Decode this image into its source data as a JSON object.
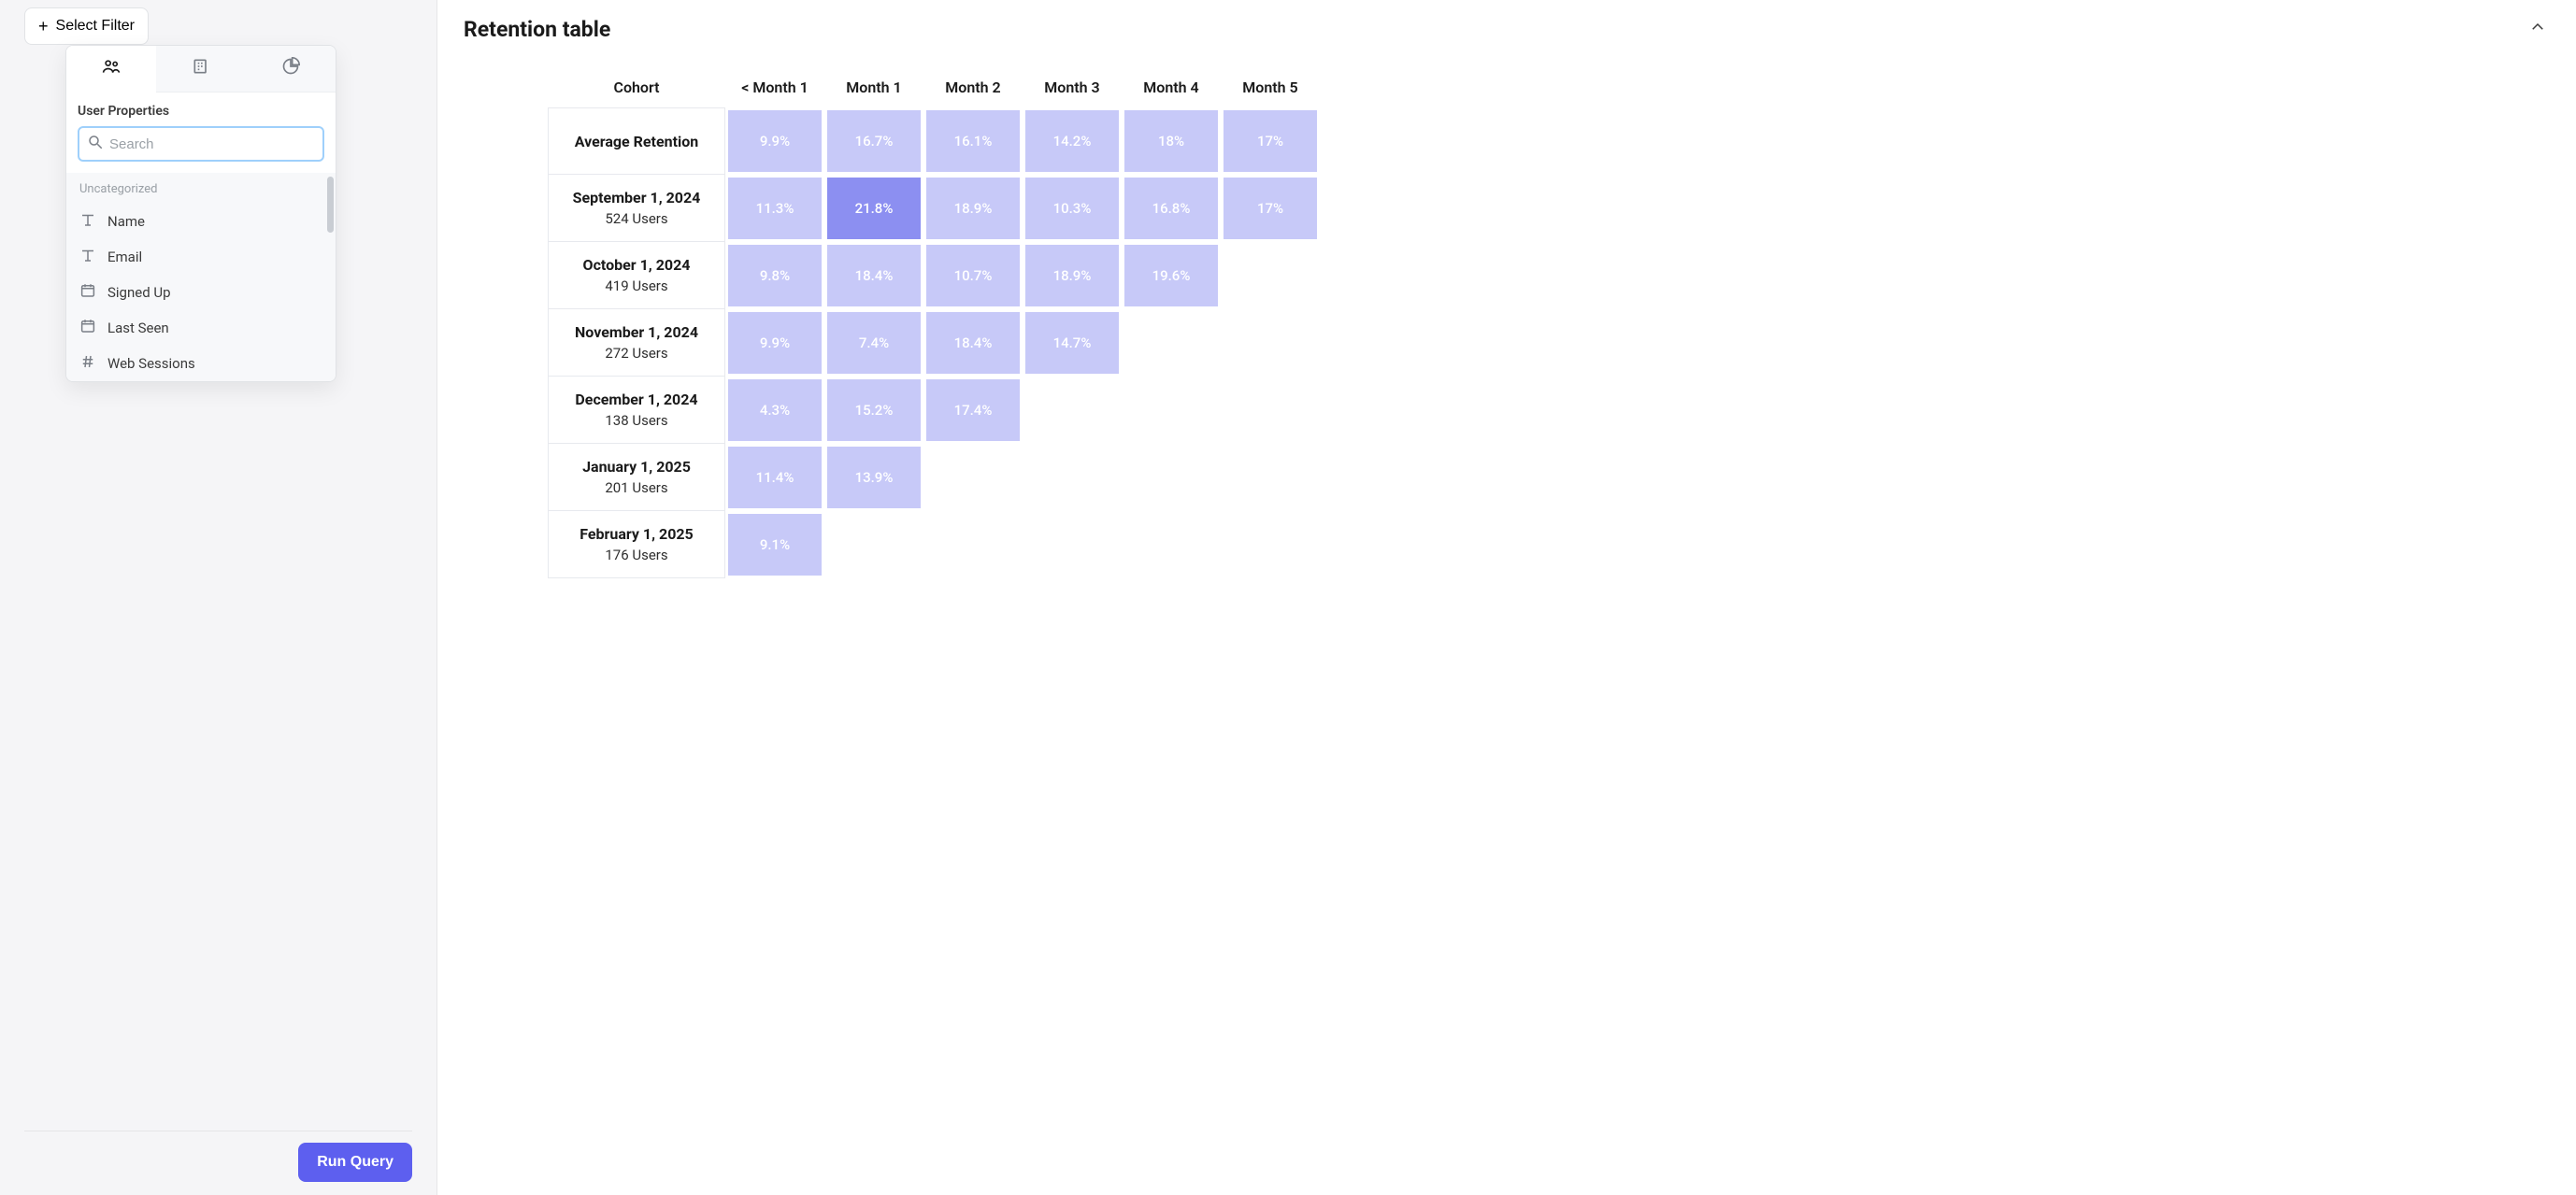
{
  "sidebar": {
    "select_filter_label": "Select Filter",
    "popover": {
      "section_title": "User Properties",
      "search_placeholder": "Search",
      "group_label": "Uncategorized",
      "items": [
        {
          "label": "Name",
          "icon": "text"
        },
        {
          "label": "Email",
          "icon": "text"
        },
        {
          "label": "Signed Up",
          "icon": "date"
        },
        {
          "label": "Last Seen",
          "icon": "date"
        },
        {
          "label": "Web Sessions",
          "icon": "number"
        }
      ]
    }
  },
  "footer": {
    "run_query_label": "Run Query"
  },
  "main": {
    "title": "Retention table"
  },
  "chart_data": {
    "type": "heatmap",
    "title": "Retention table",
    "column_header": "Cohort",
    "columns": [
      "< Month 1",
      "Month 1",
      "Month 2",
      "Month 3",
      "Month 4",
      "Month 5"
    ],
    "rows": [
      {
        "name": "Average Retention",
        "subtitle": null,
        "values": [
          "9.9%",
          "16.7%",
          "16.1%",
          "14.2%",
          "18%",
          "17%"
        ]
      },
      {
        "name": "September 1, 2024",
        "subtitle": "524 Users",
        "values": [
          "11.3%",
          "21.8%",
          "18.9%",
          "10.3%",
          "16.8%",
          "17%"
        ]
      },
      {
        "name": "October 1, 2024",
        "subtitle": "419 Users",
        "values": [
          "9.8%",
          "18.4%",
          "10.7%",
          "18.9%",
          "19.6%"
        ]
      },
      {
        "name": "November 1, 2024",
        "subtitle": "272 Users",
        "values": [
          "9.9%",
          "7.4%",
          "18.4%",
          "14.7%"
        ]
      },
      {
        "name": "December 1, 2024",
        "subtitle": "138 Users",
        "values": [
          "4.3%",
          "15.2%",
          "17.4%"
        ]
      },
      {
        "name": "January 1, 2025",
        "subtitle": "201 Users",
        "values": [
          "11.4%",
          "13.9%"
        ]
      },
      {
        "name": "February 1, 2025",
        "subtitle": "176 Users",
        "values": [
          "9.1%"
        ]
      }
    ],
    "highlight": {
      "row": 1,
      "col": 1
    }
  }
}
